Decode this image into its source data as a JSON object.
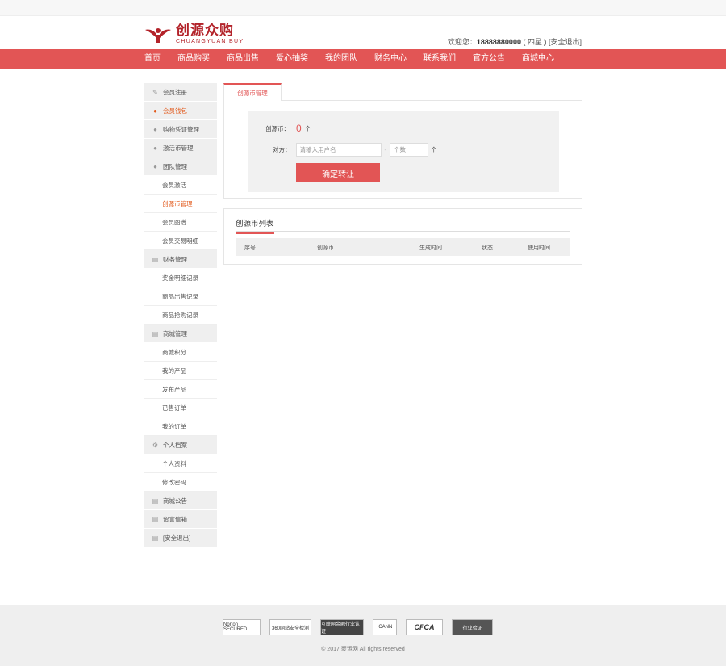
{
  "header": {
    "logo_cn": "创源众购",
    "logo_en": "CHUANGYUAN BUY",
    "welcome_prefix": "欢迎您：",
    "phone": "18888880000",
    "level": "( 四星 )",
    "logout": "[安全退出]"
  },
  "nav": [
    "首页",
    "商品购买",
    "商品出售",
    "爱心抽奖",
    "我的团队",
    "财务中心",
    "联系我们",
    "官方公告",
    "商城中心"
  ],
  "sidebar": {
    "items": [
      {
        "label": "会员注册",
        "icon": "edit-icon",
        "type": "item"
      },
      {
        "label": "会员钱包",
        "icon": "user-icon",
        "type": "item",
        "active": true
      },
      {
        "label": "购物凭证管理",
        "icon": "user-icon",
        "type": "item"
      },
      {
        "label": "激活币管理",
        "icon": "user-icon",
        "type": "item"
      },
      {
        "label": "团队管理",
        "icon": "user-icon",
        "type": "item"
      },
      {
        "label": "会员激活",
        "type": "sub"
      },
      {
        "label": "创源币管理",
        "type": "sub",
        "current": true
      },
      {
        "label": "会员图谱",
        "type": "sub"
      },
      {
        "label": "会员交易明细",
        "type": "sub"
      },
      {
        "label": "财务管理",
        "icon": "doc-icon",
        "type": "item"
      },
      {
        "label": "奖金明细记录",
        "type": "sub"
      },
      {
        "label": "商品出售记录",
        "type": "sub"
      },
      {
        "label": "商品抢购记录",
        "type": "sub"
      },
      {
        "label": "商城管理",
        "icon": "doc-icon",
        "type": "item"
      },
      {
        "label": "商城积分",
        "type": "sub"
      },
      {
        "label": "我的产品",
        "type": "sub"
      },
      {
        "label": "发布产品",
        "type": "sub"
      },
      {
        "label": "已售订单",
        "type": "sub"
      },
      {
        "label": "我的订单",
        "type": "sub"
      },
      {
        "label": "个人档案",
        "icon": "gear-icon",
        "type": "item"
      },
      {
        "label": "个人资料",
        "type": "sub"
      },
      {
        "label": "修改密码",
        "type": "sub"
      },
      {
        "label": "商城公告",
        "icon": "doc-icon",
        "type": "item"
      },
      {
        "label": "留言信箱",
        "icon": "doc-icon",
        "type": "item"
      },
      {
        "label": "[安全退出]",
        "icon": "doc-icon",
        "type": "item"
      }
    ]
  },
  "main": {
    "tab": "创源币管理",
    "coin_label": "创源币：",
    "coin_value": "0",
    "coin_unit": "个",
    "target_label": "对方：",
    "username_placeholder": "请输入用户名",
    "amount_placeholder": "个数",
    "amount_unit": "个",
    "submit": "确定转让",
    "list_title": "创源币列表",
    "columns": [
      "序号",
      "创源币",
      "生成时间",
      "状态",
      "使用时间"
    ]
  },
  "footer": {
    "badges": [
      "Norton SECURED",
      "360网站安全检测",
      "互联网金融行业认证",
      "ICANN",
      "CFCA",
      "行业验证"
    ],
    "copyright": "© 2017 聚运网 All rights reserved"
  },
  "colors": {
    "accent": "#e25555",
    "logo": "#b3232a",
    "active": "#e25a1c"
  }
}
